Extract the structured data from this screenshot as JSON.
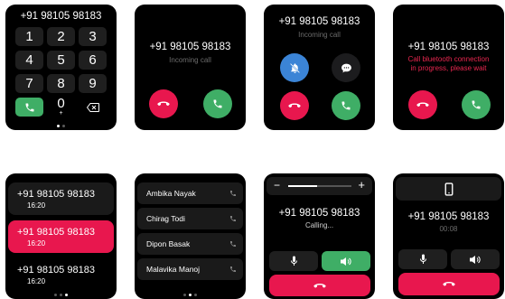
{
  "phone_number": "+91 98105 98183",
  "incoming_label": "Incoming call",
  "bluetooth_message_line1": "Call bluetooth connection",
  "bluetooth_message_line2": "in progress, please wait",
  "calling_label": "Calling...",
  "call_timer": "00:08",
  "keypad": {
    "keys": [
      "1",
      "2",
      "3",
      "4",
      "5",
      "6",
      "7",
      "8",
      "9",
      "0"
    ],
    "plus_sign": "+"
  },
  "call_log": [
    {
      "number": "+91 98105 98183",
      "time": "16:20",
      "selected": false
    },
    {
      "number": "+91 98105 98183",
      "time": "16:20",
      "selected": true
    },
    {
      "number": "+91 98105 98183",
      "time": "16:20",
      "selected": false
    }
  ],
  "contacts": [
    "Ambika Nayak",
    "Chirag Todi",
    "Dipon Basak",
    "Malavika Manoj"
  ],
  "volume": {
    "minus": "−",
    "plus": "+",
    "level": 0.45
  },
  "colors": {
    "red": "#e8174e",
    "green": "#3fae66",
    "blue": "#3b84d6",
    "screen": "#000000"
  }
}
